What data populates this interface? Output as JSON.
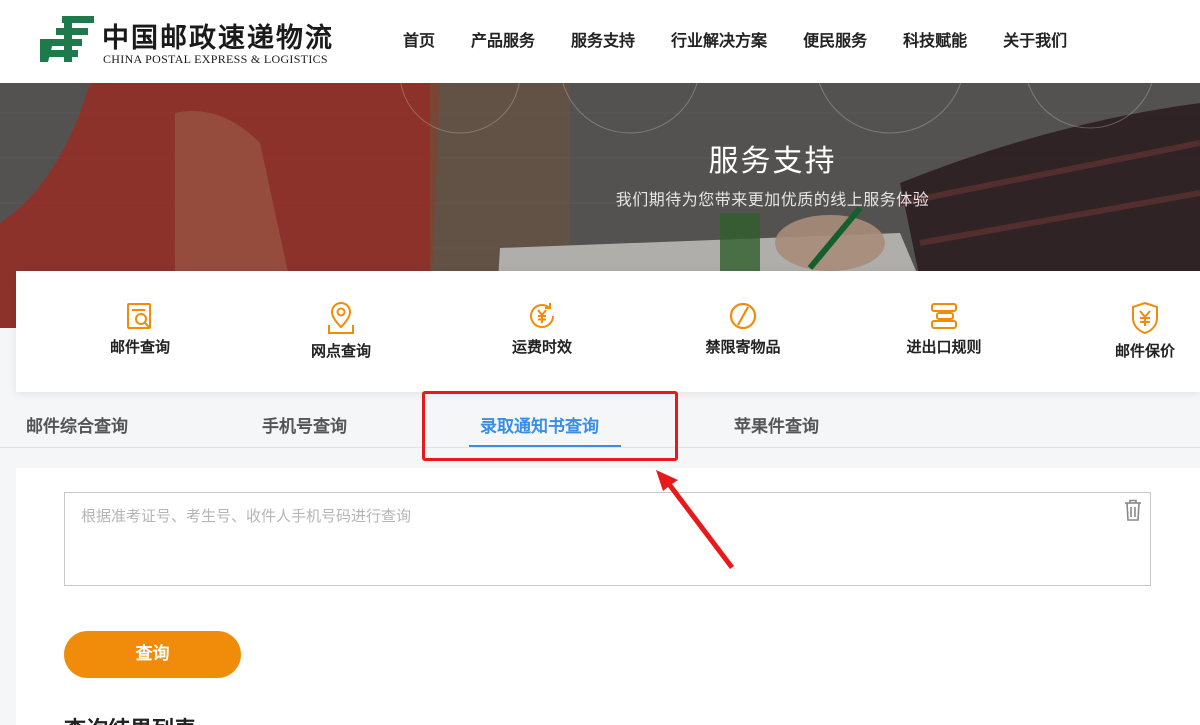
{
  "header": {
    "logo_cn": "中国邮政速递物流",
    "logo_en": "CHINA POSTAL EXPRESS & LOGISTICS",
    "nav": [
      "首页",
      "产品服务",
      "服务支持",
      "行业解决方案",
      "便民服务",
      "科技赋能",
      "关于我们"
    ]
  },
  "banner": {
    "title": "服务支持",
    "subtitle": "我们期待为您带来更加优质的线上服务体验"
  },
  "services": [
    {
      "label": "邮件查询",
      "icon": "mail-search-icon"
    },
    {
      "label": "网点查询",
      "icon": "location-pin-icon"
    },
    {
      "label": "运费时效",
      "icon": "yen-clock-icon"
    },
    {
      "label": "禁限寄物品",
      "icon": "forbidden-icon"
    },
    {
      "label": "进出口规则",
      "icon": "import-export-icon"
    },
    {
      "label": "邮件保价",
      "icon": "yen-shield-icon"
    }
  ],
  "tabs": [
    "邮件综合查询",
    "手机号查询",
    "录取通知书查询",
    "苹果件查询"
  ],
  "active_tab": "录取通知书查询",
  "query": {
    "placeholder": "根据准考证号、考生号、收件人手机号码进行查询",
    "value": ""
  },
  "search_button": "查询",
  "results_title": "查询结果列表",
  "colors": {
    "accent_orange": "#f08c0a",
    "active_blue": "#3a8ee6",
    "highlight_red": "#e8191b",
    "brand_green": "#1e7a4a"
  }
}
